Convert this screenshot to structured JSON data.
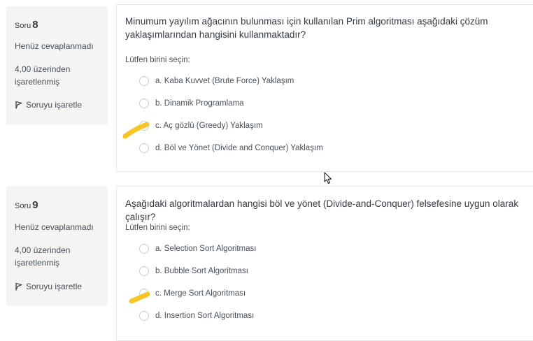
{
  "questions": [
    {
      "label": "Soru",
      "number": "8",
      "state": "Henüz cevaplanmadı",
      "grade": "4,00 üzerinden işaretlenmiş",
      "flag_label": "Soruyu işaretle",
      "text": "Minumum yayılım ağacının bulunması için kullanılan Prim algoritması aşağıdaki çözüm yaklaşımlarından hangisini kullanmaktadır?",
      "prompt": "Lütfen birini seçin:",
      "answers": [
        "a. Kaba Kuvvet (Brute Force) Yaklaşım",
        "b. Dinamik Programlama",
        "c. Aç gözlü (Greedy) Yaklaşım",
        "d. Böl ve Yönet (Divide and Conquer) Yaklaşım"
      ]
    },
    {
      "label": "Soru",
      "number": "9",
      "state": "Henüz cevaplanmadı",
      "grade": "4,00 üzerinden işaretlenmiş",
      "flag_label": "Soruyu işaretle",
      "text": "Aşağıdaki algoritmalardan hangisi böl ve yönet (Divide-and-Conquer) felsefesine uygun olarak çalışır?",
      "prompt": "Lütfen birini seçin:",
      "answers": [
        "a. Selection Sort Algoritması",
        "b. Bubble Sort Algoritması",
        "c. Merge Sort Algoritması",
        "d. Insertion Sort Algoritması"
      ]
    }
  ],
  "colors": {
    "highlight": "#f7c21b",
    "info_bg": "#f4f4f5"
  },
  "icons": {
    "flag": "flag-icon",
    "cursor": "mouse-pointer-icon"
  }
}
